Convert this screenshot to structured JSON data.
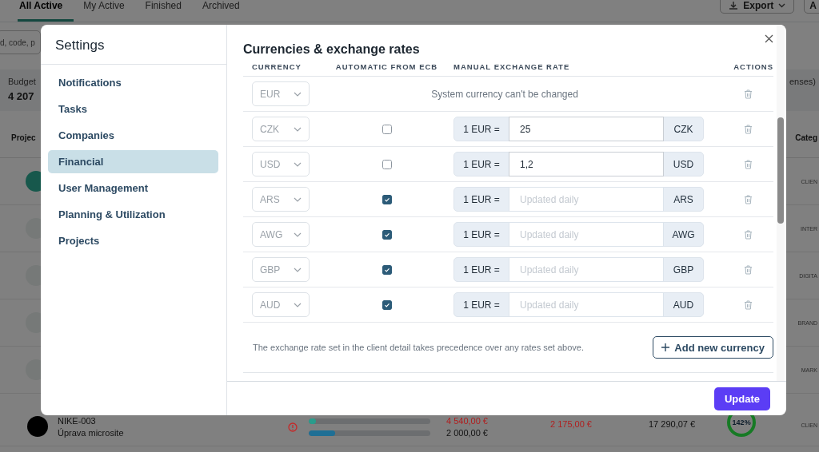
{
  "background": {
    "tabs": [
      {
        "label": "All Active",
        "selected": true
      },
      {
        "label": "My Active",
        "selected": false
      },
      {
        "label": "Finished",
        "selected": false
      },
      {
        "label": "Archived",
        "selected": false
      }
    ],
    "export_button": "Export",
    "button_2": "A",
    "search": {
      "placeholder": "d, code, p"
    },
    "budget": {
      "label": "Budget",
      "value": "4 207",
      "note": "enses)"
    },
    "table": {
      "columns": [
        "Projec",
        "Categ"
      ],
      "rows": [
        {
          "color": "#17584c",
          "category": "CLIEN"
        },
        {
          "color": "#767978",
          "category": "INTER"
        },
        {
          "color": "#767978",
          "category": "DIGITA"
        },
        {
          "color": "#767978",
          "category": "BRAND"
        },
        {
          "color": "#767978",
          "category": "MARK"
        },
        {
          "color": "#000000",
          "category": "CLIEN",
          "code": "NIKE-003",
          "name": "Úprava microsite",
          "bars": [
            {
              "level": 0.06
            },
            {
              "level": 0.22
            }
          ],
          "cost_1": "4 540,00 €",
          "cost_2": "2 000,00 €",
          "difference": "2 175,00 €",
          "total": "17 290,07 €",
          "percent": "142%"
        }
      ]
    }
  },
  "settings": {
    "title": "Settings",
    "nav": [
      {
        "label": "Notifications",
        "selected": false
      },
      {
        "label": "Tasks",
        "selected": false
      },
      {
        "label": "Companies",
        "selected": false
      },
      {
        "label": "Financial",
        "selected": true
      },
      {
        "label": "User Management",
        "selected": false
      },
      {
        "label": "Planning & Utilization",
        "selected": false
      },
      {
        "label": "Projects",
        "selected": false
      }
    ],
    "section_title": "Currencies & exchange rates",
    "columns": [
      "CURRENCY",
      "AUTOMATIC FROM ECB",
      "MANUAL EXCHANGE RATE",
      "ACTIONS"
    ],
    "rows": [
      {
        "kind": "system",
        "currency": "EUR",
        "note": "System currency can't be changed"
      },
      {
        "kind": "rate",
        "currency": "CZK",
        "automatic": false,
        "prefix": "1 EUR =",
        "value": "25",
        "suffix": "CZK"
      },
      {
        "kind": "rate",
        "currency": "USD",
        "automatic": false,
        "prefix": "1 EUR =",
        "value": "1,2",
        "suffix": "USD"
      },
      {
        "kind": "rate",
        "currency": "ARS",
        "automatic": true,
        "prefix": "1 EUR =",
        "placeholder": "Updated daily",
        "suffix": "ARS"
      },
      {
        "kind": "rate",
        "currency": "AWG",
        "automatic": true,
        "prefix": "1 EUR =",
        "placeholder": "Updated daily",
        "suffix": "AWG"
      },
      {
        "kind": "rate",
        "currency": "GBP",
        "automatic": true,
        "prefix": "1 EUR =",
        "placeholder": "Updated daily",
        "suffix": "GBP"
      },
      {
        "kind": "rate",
        "currency": "AUD",
        "automatic": true,
        "prefix": "1 EUR =",
        "placeholder": "Updated daily",
        "suffix": "AUD"
      }
    ],
    "footnote": "The exchange rate set in the client detail takes precedence over any rates set above.",
    "add_button": "Add new currency",
    "update_button": "Update"
  }
}
